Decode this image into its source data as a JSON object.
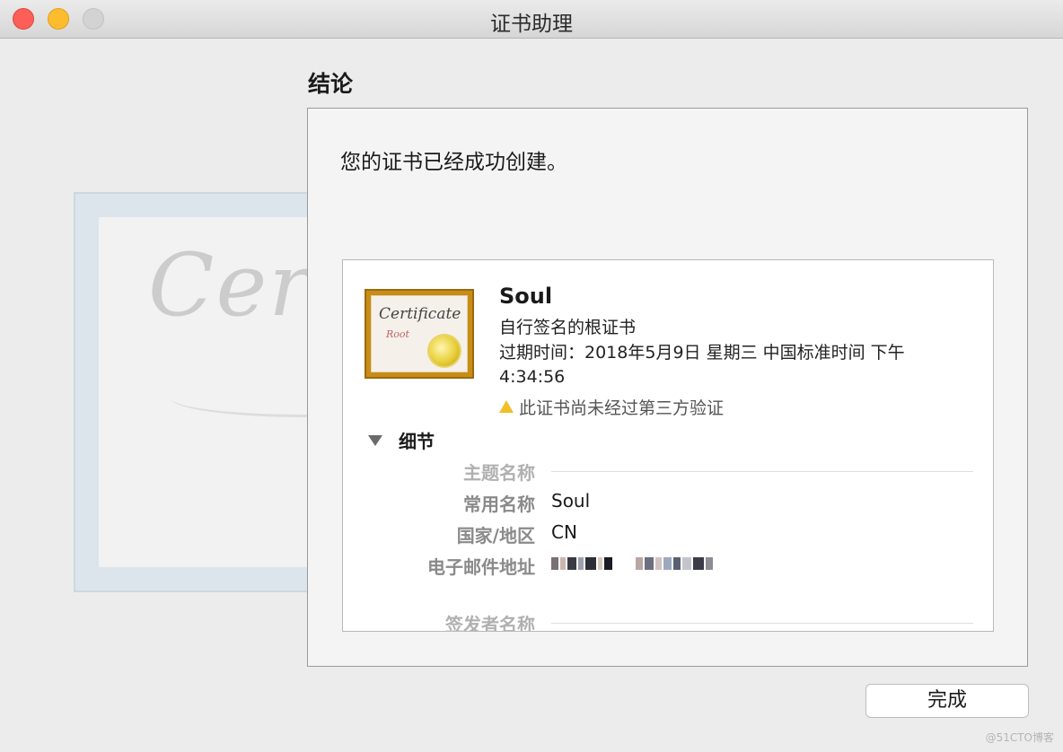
{
  "window": {
    "title": "证书助理"
  },
  "section": {
    "title": "结论"
  },
  "message": "您的证书已经成功创建。",
  "certificate": {
    "icon_title": "Certificate",
    "icon_subtitle": "Root",
    "background_word": "Certif",
    "name": "Soul",
    "type": "自行签名的根证书",
    "expiry": "过期时间：2018年5月9日 星期三 中国标准时间 下午4:34:56",
    "warning": "此证书尚未经过第三方验证"
  },
  "details": {
    "toggle_label": "细节",
    "subject_header": "主题名称",
    "common_name_label": "常用名称",
    "common_name_value": "Soul",
    "country_label": "国家/地区",
    "country_value": "CN",
    "email_label": "电子邮件地址",
    "issuer_header": "签发者名称"
  },
  "buttons": {
    "done": "完成"
  },
  "watermark": "@51CTO博客",
  "colors": {
    "close": "#fc5f57",
    "minimize": "#fdbc2e",
    "zoom": "#d3d3d3",
    "cert_frame": "#c88d16"
  },
  "icons": [
    "close-icon",
    "minimize-icon",
    "zoom-icon",
    "certificate-icon",
    "warning-icon",
    "disclosure-triangle-icon"
  ]
}
